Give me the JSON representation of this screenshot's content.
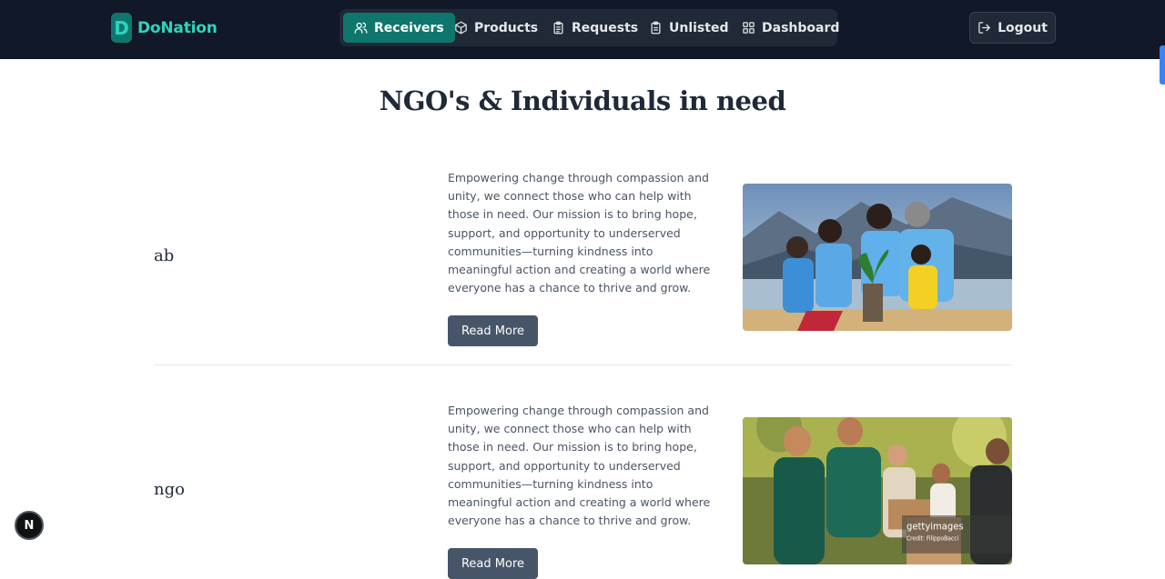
{
  "brand": {
    "logo_letter": "D",
    "name": "DoNation"
  },
  "nav": {
    "items": [
      {
        "label": "Receivers",
        "icon": "users-icon",
        "active": true
      },
      {
        "label": "Products",
        "icon": "box-icon",
        "active": false
      },
      {
        "label": "Requests",
        "icon": "clipboard-list-icon",
        "active": false
      },
      {
        "label": "Unlisted",
        "icon": "clipboard-icon",
        "active": false
      },
      {
        "label": "Dashboard",
        "icon": "dashboard-grid-icon",
        "active": false
      }
    ],
    "logout_label": "Logout"
  },
  "page": {
    "title": "NGO's & Individuals in need"
  },
  "receivers": [
    {
      "name": "ab",
      "description": "Empowering change through compassion and unity, we connect those who can help with those in need. Our mission is to bring hope, support, and opportunity to underserved communities—turning kindness into meaningful action and creating a world where everyone has a chance to thrive and grow.",
      "button_label": "Read More",
      "image": "volunteers-planting-photo"
    },
    {
      "name": "ngo",
      "description": "Empowering change through compassion and unity, we connect those who can help with those in need. Our mission is to bring hope, support, and opportunity to underserved communities—turning kindness into meaningful action and creating a world where everyone has a chance to thrive and grow.",
      "button_label": "Read More",
      "image": "volunteers-food-distribution-photo",
      "watermark": "gettyimages",
      "credit": "Credit: FilippoBacci"
    }
  ],
  "dev_badge": {
    "letter": "N"
  },
  "colors": {
    "navbar": "#111827",
    "accent": "#0f766e",
    "brand_text": "#2dd4bf",
    "button": "#475569"
  }
}
